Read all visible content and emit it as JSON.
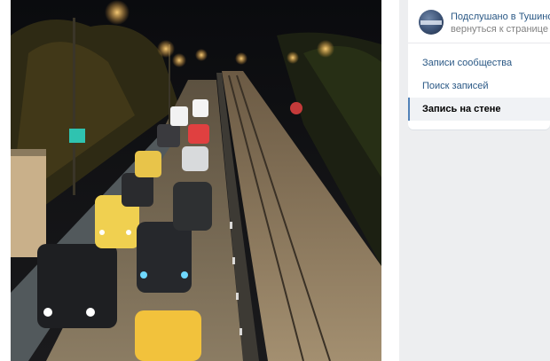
{
  "group": {
    "name": "Подслушано в Тушино",
    "back_label": "вернуться к странице"
  },
  "menu": {
    "items": [
      {
        "label": "Записи сообщества",
        "active": false
      },
      {
        "label": "Поиск записей",
        "active": false
      },
      {
        "label": "Запись на стене",
        "active": true
      }
    ]
  },
  "colors": {
    "link": "#2a5885",
    "muted": "#828282",
    "active_bar": "#5181b8",
    "page_bg": "#edeef0"
  }
}
